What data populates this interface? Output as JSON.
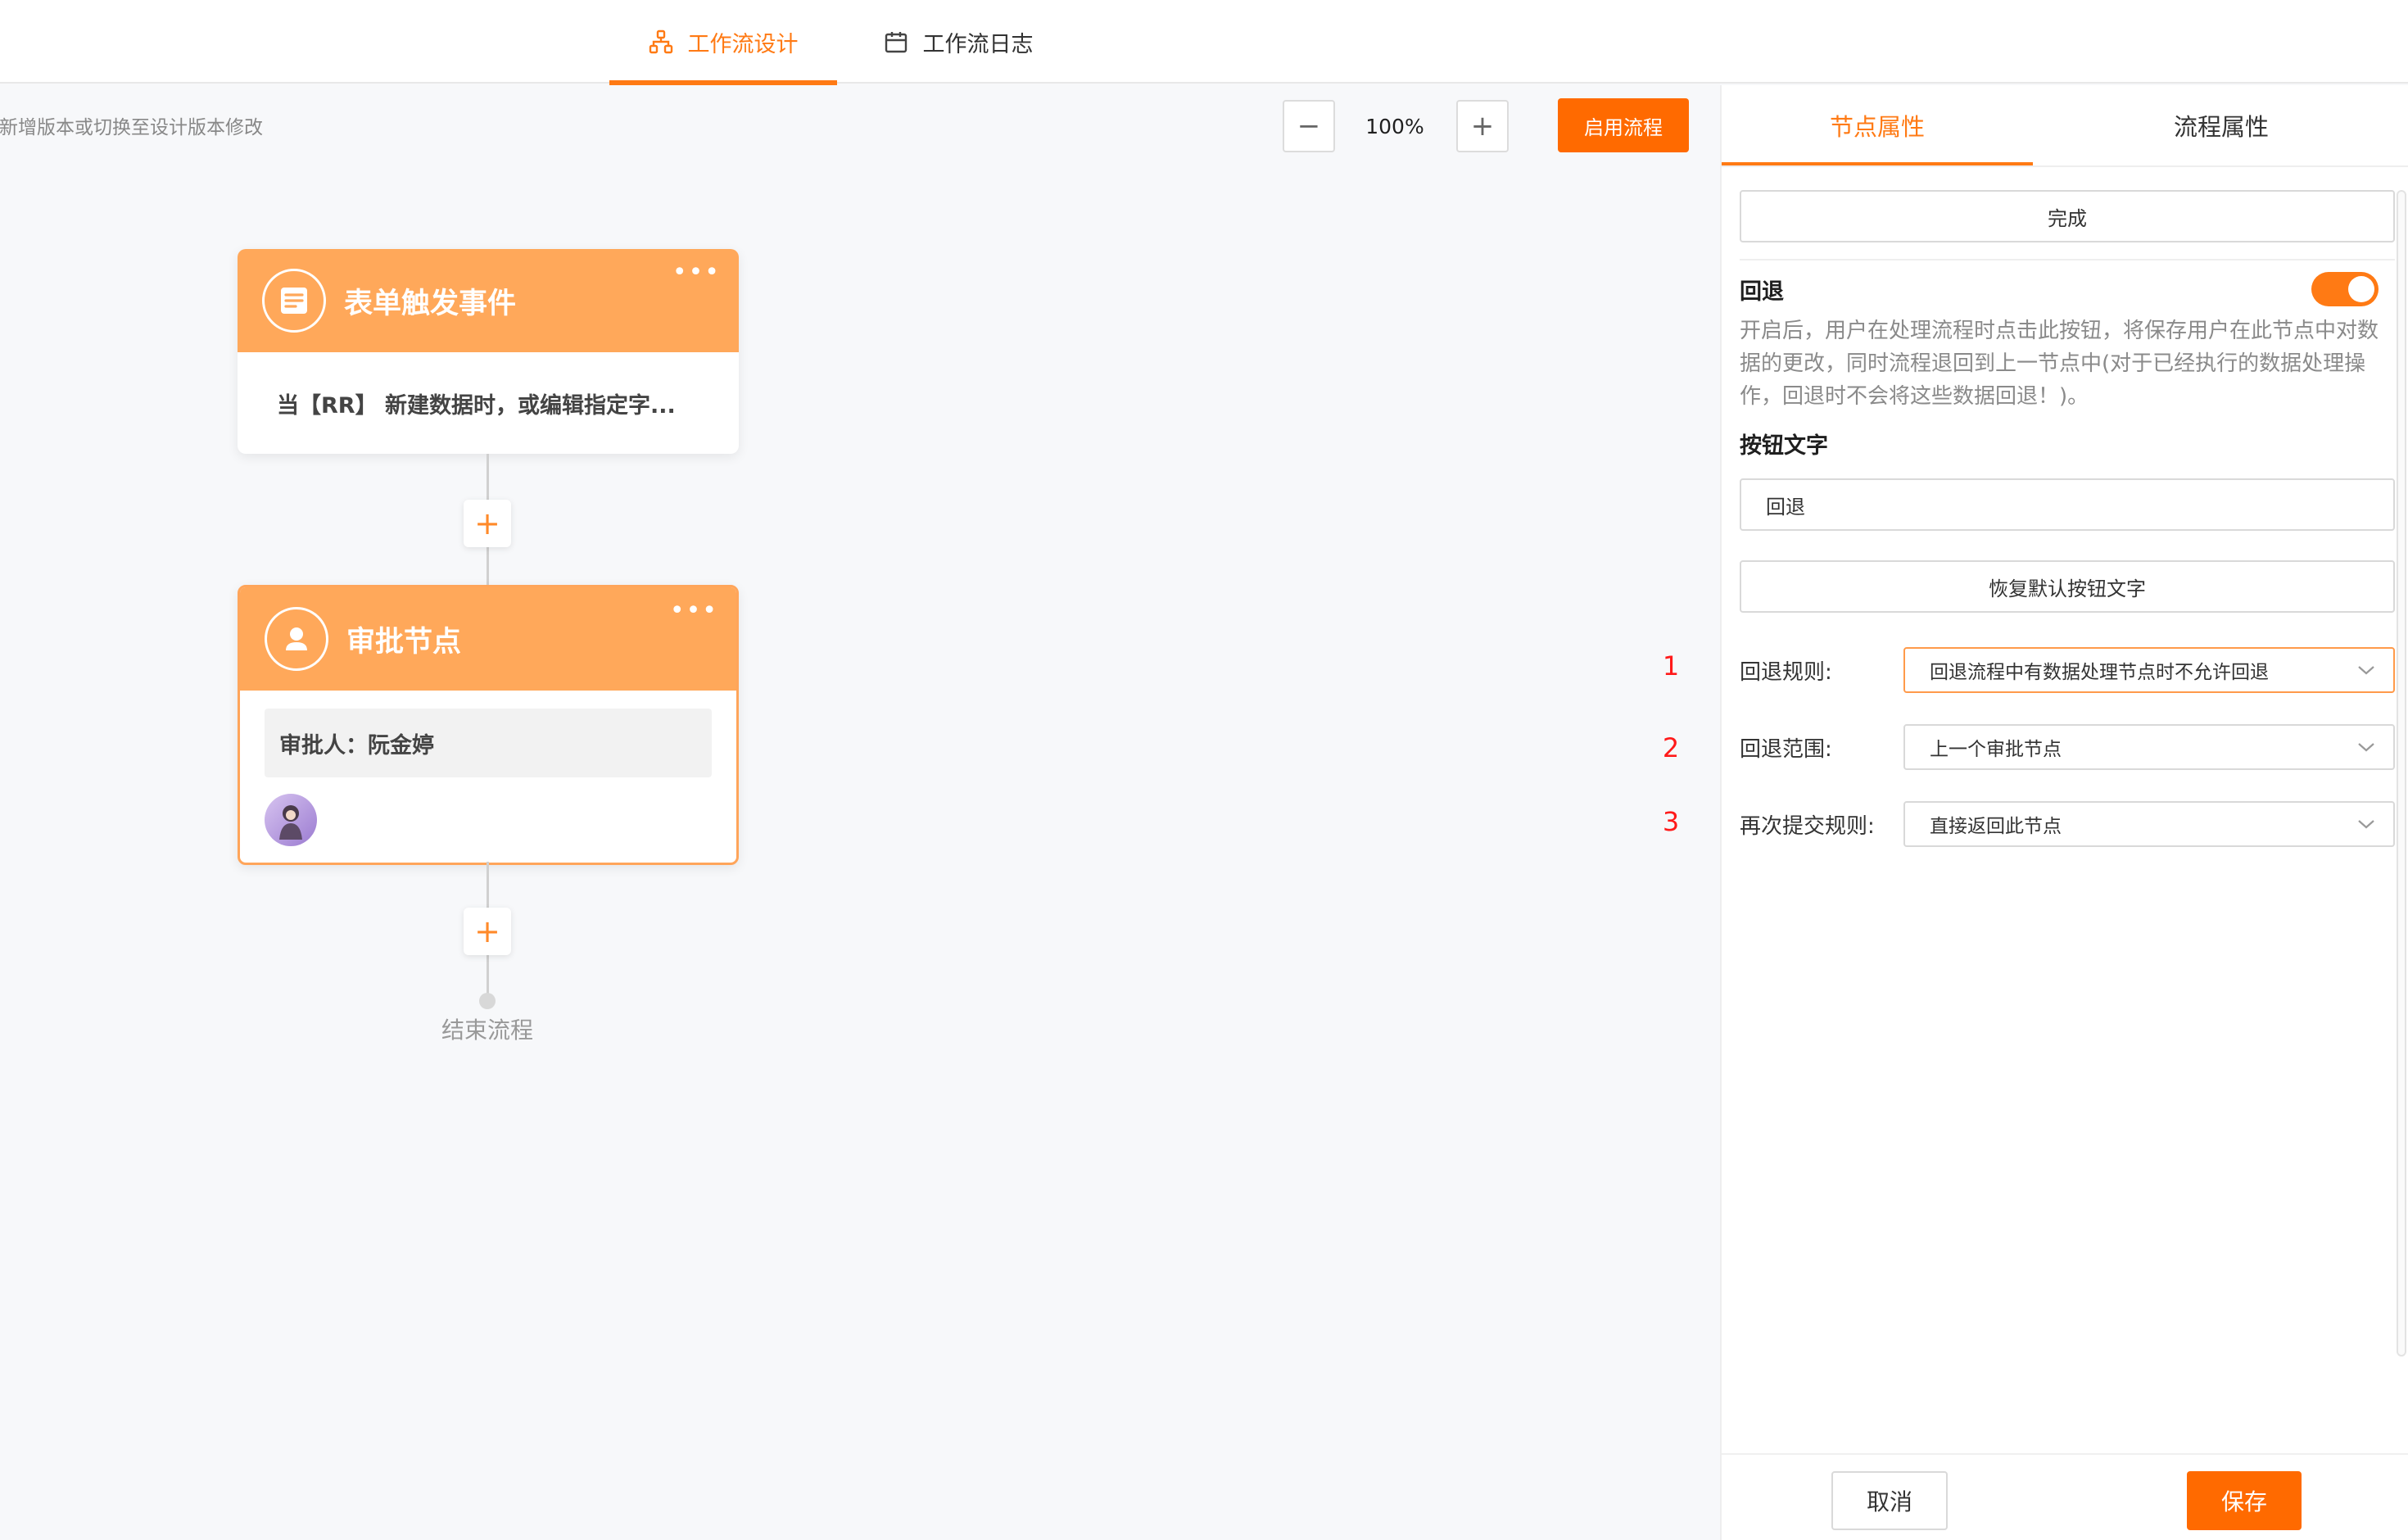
{
  "top_tabs": [
    {
      "label": "工作流设计",
      "icon": "flow-icon",
      "active": true
    },
    {
      "label": "工作流日志",
      "icon": "calendar-icon",
      "active": false
    }
  ],
  "canvas": {
    "hint": "请新增版本或切换至设计版本修改",
    "zoom_out_label": "−",
    "zoom_level": "100%",
    "zoom_in_label": "+",
    "enable_button": "启用流程"
  },
  "nodes": {
    "trigger": {
      "title": "表单触发事件",
      "more": "•••",
      "description": "当【RR】 新建数据时，或编辑指定字...",
      "icon": "form-icon"
    },
    "approval": {
      "title": "审批节点",
      "more": "•••",
      "approver": "审批人：阮金婷",
      "icon": "approver-icon"
    },
    "add_label": "+",
    "end_label": "结束流程"
  },
  "markers": [
    "1",
    "2",
    "3"
  ],
  "panel": {
    "tabs": [
      {
        "label": "节点属性",
        "active": true
      },
      {
        "label": "流程属性",
        "active": false
      }
    ],
    "complete_button": "完成",
    "rollback": {
      "title": "回退",
      "enabled": true,
      "description": "开启后，用户在处理流程时点击此按钮，将保存用户在此节点中对数据的更改，同时流程退回到上一节点中(对于已经执行的数据处理操作，回退时不会将这些数据回退！)。"
    },
    "button_text": {
      "label": "按钮文字",
      "value": "回退",
      "reset_button": "恢复默认按钮文字"
    },
    "rules": [
      {
        "label": "回退规则:",
        "value": "回退流程中有数据处理节点时不允许回退"
      },
      {
        "label": "回退范围:",
        "value": "上一个审批节点"
      },
      {
        "label": "再次提交规则:",
        "value": "直接返回此节点"
      }
    ],
    "cancel_button": "取消",
    "save_button": "保存"
  },
  "colors": {
    "accent": "#ff6a00",
    "node_header": "#ffa85a",
    "marker": "#ff1a1a"
  }
}
